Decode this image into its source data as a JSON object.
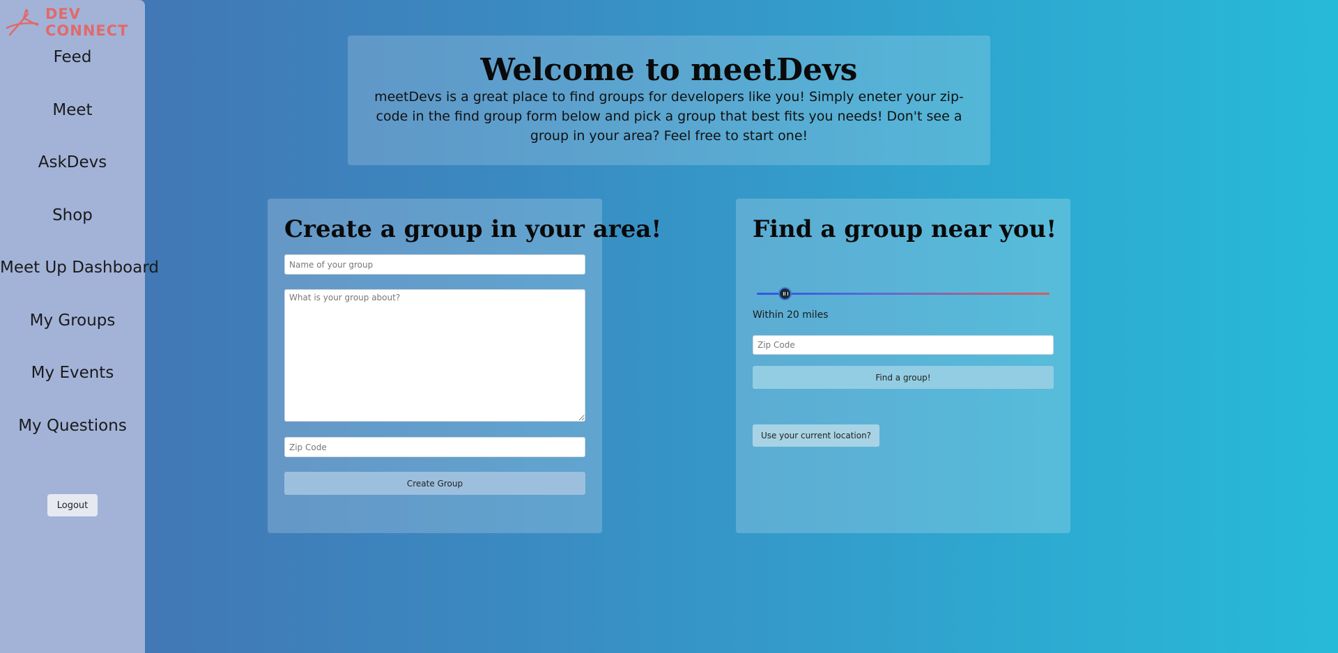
{
  "sidebar": {
    "logo": {
      "line1": "DEV",
      "line2": "CONNECT",
      "color": "#e06a6a"
    },
    "nav_items": [
      {
        "label": "Feed"
      },
      {
        "label": "Meet"
      },
      {
        "label": "AskDevs"
      },
      {
        "label": "Shop"
      },
      {
        "label": "Meet Up Dashboard"
      },
      {
        "label": "My Groups"
      },
      {
        "label": "My Events"
      },
      {
        "label": "My Questions"
      }
    ],
    "logout_label": "Logout"
  },
  "welcome": {
    "title": "Welcome to meetDevs",
    "description": "meetDevs is a great place to find groups for developers like you! Simply eneter your zip-code in the find group form below and pick a group that best fits you needs! Don't see a group in your area? Feel free to start one!"
  },
  "create_group": {
    "heading": "Create a group in your area!",
    "name_placeholder": "Name of your group",
    "about_placeholder": "What is your group about?",
    "zip_placeholder": "Zip Code",
    "submit_label": "Create Group"
  },
  "find_group": {
    "heading": "Find a group near you!",
    "distance_miles": 20,
    "distance_fraction": 0.095,
    "distance_label": "Within 20 miles",
    "zip_placeholder": "Zip Code",
    "submit_label": "Find a group!",
    "location_label": "Use your current location?"
  },
  "colors": {
    "sidebar_bg": "#a3b3d8",
    "background_start": "#4470b0",
    "background_end": "#27bad8",
    "slider_start": "#2e57e0",
    "slider_end": "#e05a5a"
  }
}
